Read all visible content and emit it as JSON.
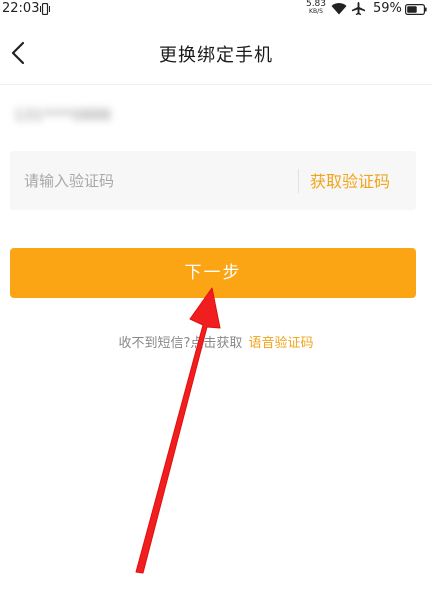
{
  "status_bar": {
    "time": "22:03",
    "net_speed_value": "5.83",
    "net_speed_unit": "KB/S",
    "battery_percent": "59%"
  },
  "header": {
    "title": "更换绑定手机"
  },
  "phone": {
    "masked_number": "131****0888"
  },
  "code_field": {
    "placeholder": "请输入验证码",
    "value": "",
    "get_code_label": "获取验证码"
  },
  "next_button": {
    "label": "下一步"
  },
  "hint": {
    "text": "收不到短信?点击获取",
    "voice_link": "语音验证码"
  },
  "colors": {
    "accent": "#fba414",
    "link": "#f0a419",
    "annotation_arrow": "#f01e1e"
  },
  "icons": {
    "back": "chevron-left-icon",
    "vibrate": "vibrate-icon",
    "wifi": "wifi-icon",
    "airplane": "airplane-icon",
    "battery": "battery-icon"
  }
}
